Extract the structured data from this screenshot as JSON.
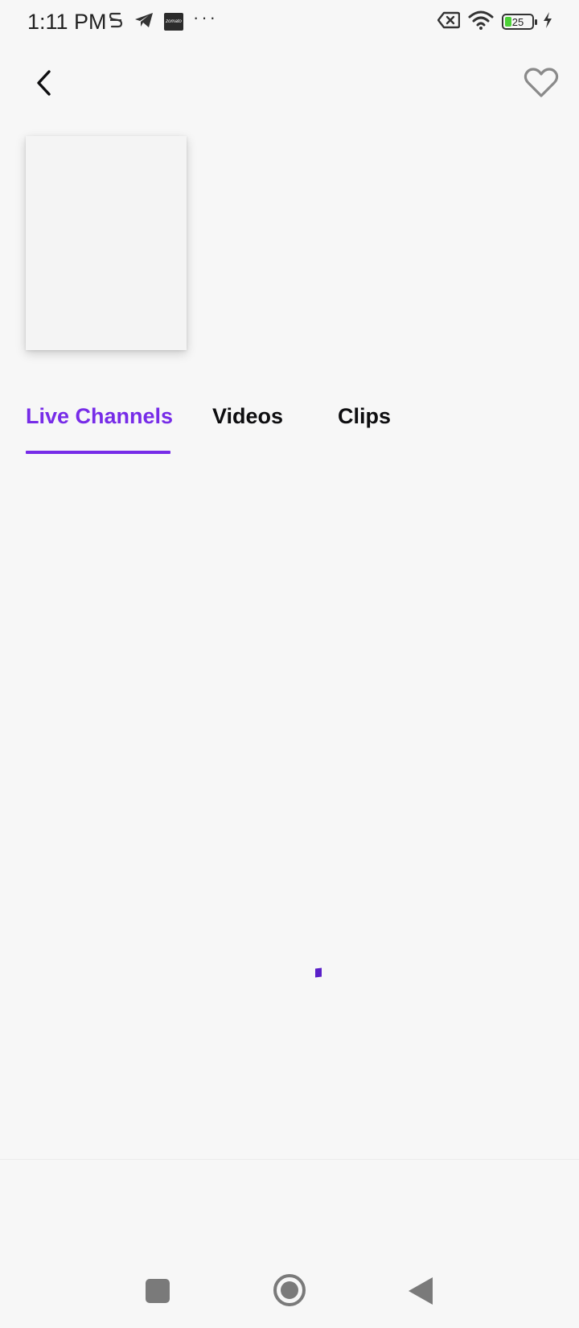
{
  "status_bar": {
    "time": "1:11 PM",
    "notification_icons": [
      "data-saver-icon",
      "telegram-icon",
      "zomato-icon",
      "more-notifications-icon"
    ],
    "zomato_text": "zomato",
    "more_dots": "···",
    "battery_level": "25",
    "right_icons": [
      "sim-off-icon",
      "wifi-icon",
      "battery-icon",
      "charging-icon"
    ]
  },
  "header": {
    "back_icon": "chevron-left-icon",
    "favorite_icon": "heart-outline-icon"
  },
  "tabs": [
    {
      "label": "Live Channels",
      "active": true
    },
    {
      "label": "Videos",
      "active": false
    },
    {
      "label": "Clips",
      "active": false
    }
  ],
  "colors": {
    "accent": "#772ce8",
    "background": "#f7f7f7",
    "text": "#0e0e10",
    "nav_icons": "#7a7a7a",
    "spinner": "#5a20c8"
  },
  "nav_bar": {
    "recents_icon": "square-icon",
    "home_icon": "circle-home-icon",
    "back_icon": "triangle-back-icon"
  }
}
